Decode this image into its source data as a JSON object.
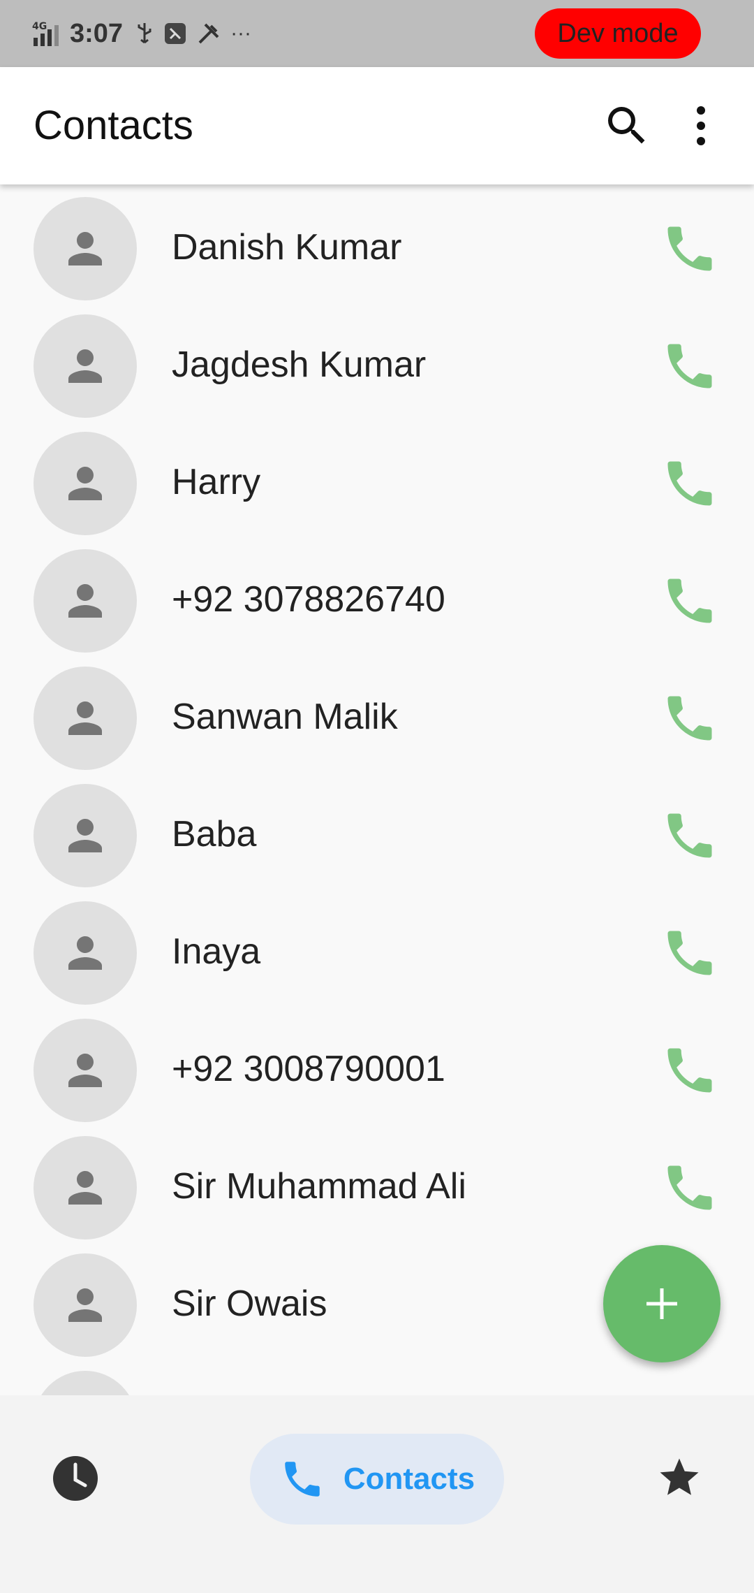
{
  "status_bar": {
    "network": "4G",
    "time": "3:07",
    "more": "···",
    "dev_mode_label": "Dev mode"
  },
  "app_bar": {
    "title": "Contacts"
  },
  "contacts": [
    {
      "name": "Danish Kumar"
    },
    {
      "name": "Jagdesh Kumar"
    },
    {
      "name": "Harry"
    },
    {
      "name": "+92 3078826740"
    },
    {
      "name": "Sanwan Malik"
    },
    {
      "name": "Baba"
    },
    {
      "name": "Inaya"
    },
    {
      "name": "+92 3008790001"
    },
    {
      "name": "Sir Muhammad Ali"
    },
    {
      "name": "Sir Owais"
    },
    {
      "name": ""
    }
  ],
  "bottom_nav": {
    "contacts_label": "Contacts"
  },
  "colors": {
    "call_icon": "#81c784",
    "fab": "#66bb6a",
    "active_nav": "#2196f3",
    "dev_badge": "#ff0000"
  }
}
